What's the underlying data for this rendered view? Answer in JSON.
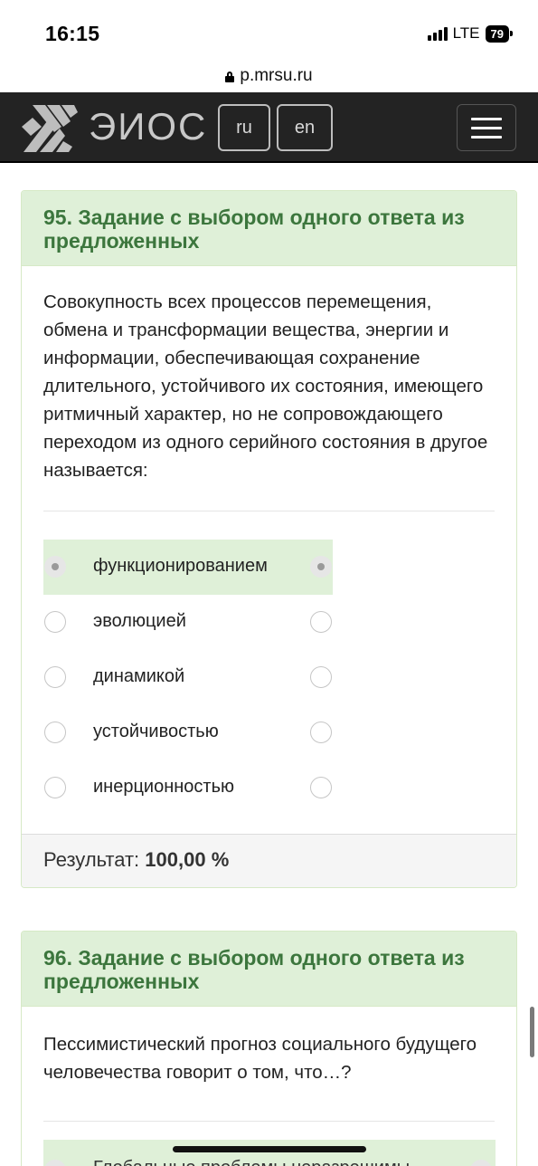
{
  "status_bar": {
    "time": "16:15",
    "network": "LTE",
    "battery": "79",
    "signal_icon": "cellular-signal-icon"
  },
  "browser": {
    "url": "p.mrsu.ru",
    "lock_icon": "lock-icon"
  },
  "navbar": {
    "brand": "ЭИОС",
    "languages": [
      "ru",
      "en"
    ],
    "menu_icon": "hamburger-menu-icon",
    "background": "#232323"
  },
  "questions": [
    {
      "title": "95. Задание с выбором одного ответа из предложенных",
      "text": "Совокупность всех процессов перемещения, обмена и трансформации вещества, энергии и информации, обеспечивающая сохранение длительного, устойчивого их состояния, имеющего ритмичный характер, но не сопровождающего переходом из одного серийного состояния в другое называется:",
      "answers": [
        {
          "label": "функционированием",
          "selected": true
        },
        {
          "label": "эволюцией",
          "selected": false
        },
        {
          "label": "динамикой",
          "selected": false
        },
        {
          "label": "устойчивостью",
          "selected": false
        },
        {
          "label": "инерционностью",
          "selected": false
        }
      ],
      "result_label": "Результат:",
      "result_value": "100,00 %"
    },
    {
      "title": "96. Задание с выбором одного ответа из предложенных",
      "text": "Пессимистический прогноз социального будущего человечества говорит о том, что…?",
      "answers": [
        {
          "label": "Глобальные проблемы неразрешимы",
          "selected": true
        }
      ]
    }
  ],
  "colors": {
    "header_green_bg": "#dff0d8",
    "header_green_text": "#3c763d",
    "selected_answer_bg": "#dff0d8"
  }
}
